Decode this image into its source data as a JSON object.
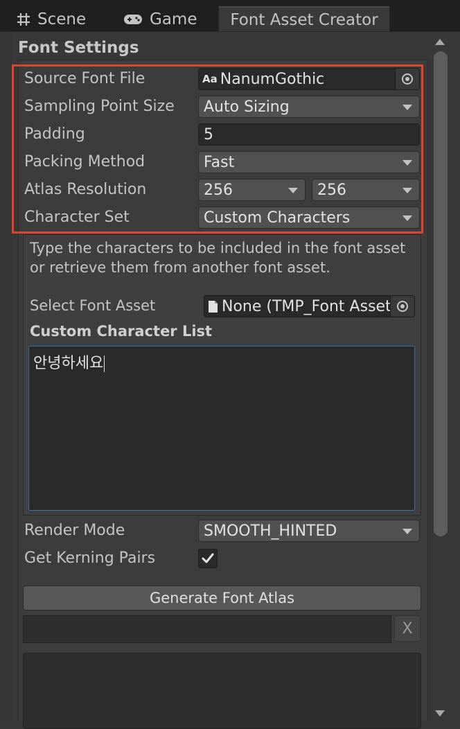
{
  "tabs": [
    {
      "label": "Scene",
      "icon": "grid-icon"
    },
    {
      "label": "Game",
      "icon": "gamepad-icon"
    },
    {
      "label": "Font Asset Creator",
      "active": true
    }
  ],
  "section": {
    "title": "Font Settings"
  },
  "fields": {
    "source_font": {
      "label": "Source Font File",
      "icon_text": "Aa",
      "value": "NanumGothic"
    },
    "sampling_point_size": {
      "label": "Sampling Point Size",
      "value": "Auto Sizing"
    },
    "padding": {
      "label": "Padding",
      "value": "5"
    },
    "packing_method": {
      "label": "Packing Method",
      "value": "Fast"
    },
    "atlas_resolution": {
      "label": "Atlas Resolution",
      "width": "256",
      "height": "256"
    },
    "character_set": {
      "label": "Character Set",
      "value": "Custom Characters"
    }
  },
  "character_set_box": {
    "help_text": "Type the characters to be included in the font asset or retrieve them from another font asset.",
    "select_font_asset": {
      "label": "Select Font Asset",
      "value": "None (TMP_Font Asset)"
    },
    "custom_list_label": "Custom Character List",
    "custom_list_value": "안녕하세요"
  },
  "render_mode": {
    "label": "Render Mode",
    "value": "SMOOTH_HINTED"
  },
  "kerning": {
    "label": "Get Kerning Pairs",
    "checked": true
  },
  "generate_button": "Generate Font Atlas",
  "progress": {
    "fraction": 0,
    "cancel_label": "X"
  },
  "colors": {
    "highlight": "#e2432a",
    "focus_border": "#3d6e9e",
    "background": "#383838"
  }
}
